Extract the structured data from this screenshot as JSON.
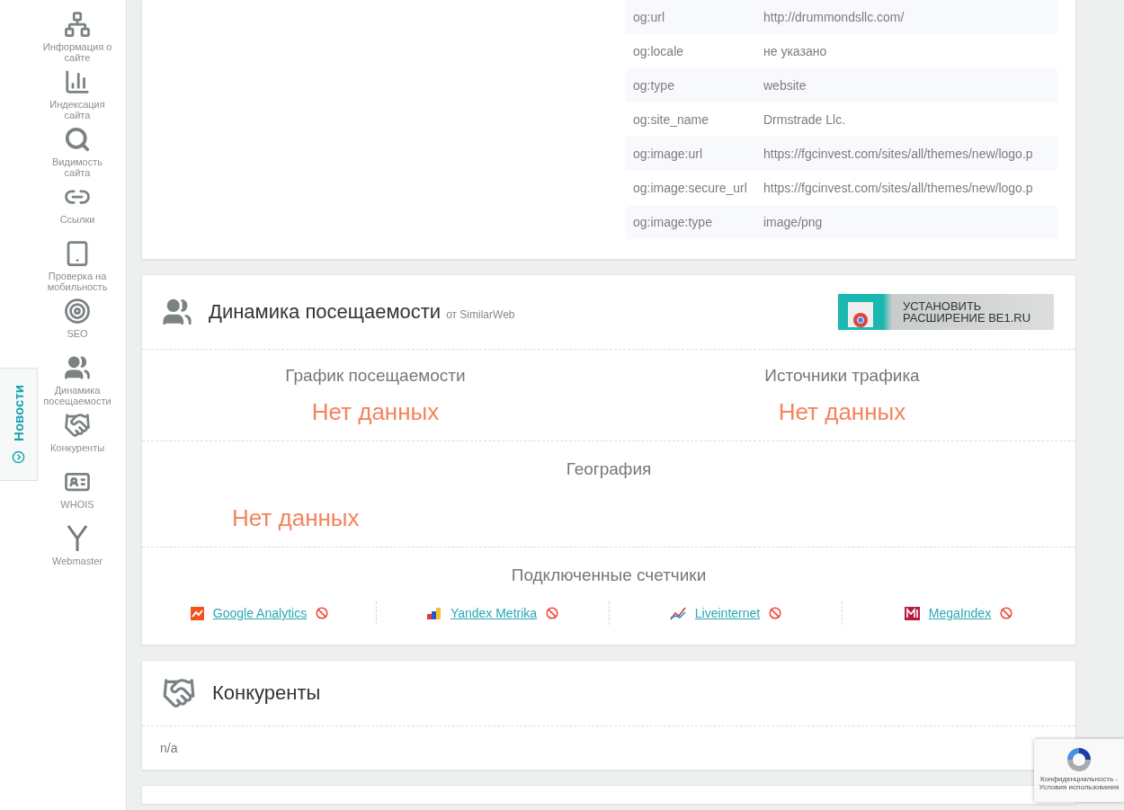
{
  "sidebar": {
    "items": [
      {
        "label": "Информация о сайте"
      },
      {
        "label": "Индексация сайта"
      },
      {
        "label": "Видимость сайта"
      },
      {
        "label": "Ссылки"
      },
      {
        "label": "Проверка на мобильность"
      },
      {
        "label": "SEO"
      },
      {
        "label": "Динамика посещаемости"
      },
      {
        "label": "Конкуренты"
      },
      {
        "label": "WHOIS"
      },
      {
        "label": "Webmaster"
      }
    ]
  },
  "news_tab": {
    "label": "Новости"
  },
  "og_table": {
    "rows": [
      {
        "key": "og:url",
        "value": "http://drummondsllc.com/"
      },
      {
        "key": "og:locale",
        "value": "не указано"
      },
      {
        "key": "og:type",
        "value": "website"
      },
      {
        "key": "og:site_name",
        "value": "Drmstrade Llc."
      },
      {
        "key": "og:image:url",
        "value": "https://fgcinvest.com/sites/all/themes/new/logo.p"
      },
      {
        "key": "og:image:secure_url",
        "value": "https://fgcinvest.com/sites/all/themes/new/logo.p"
      },
      {
        "key": "og:image:type",
        "value": "image/png"
      }
    ]
  },
  "traffic": {
    "title": "Динамика посещаемости",
    "source": "от SimilarWeb",
    "banner": {
      "line1": "УСТАНОВИТЬ",
      "line2": "РАСШИРЕНИЕ BE1.RU"
    },
    "blocks": [
      {
        "title": "График посещаемости",
        "value": "Нет данных"
      },
      {
        "title": "Источники трафика",
        "value": "Нет данных"
      }
    ],
    "geography": {
      "title": "География",
      "value": "Нет данных"
    },
    "counters": {
      "title": "Подключенные счетчики",
      "items": [
        {
          "name": "Google Analytics",
          "connected": false
        },
        {
          "name": "Yandex Metrika",
          "connected": false
        },
        {
          "name": "Liveinternet",
          "connected": false
        },
        {
          "name": "MegaIndex",
          "connected": false
        }
      ]
    }
  },
  "competitors": {
    "title": "Конкуренты",
    "value": "n/a"
  },
  "recaptcha": {
    "text": "Конфиденциальность - Условия использования"
  }
}
